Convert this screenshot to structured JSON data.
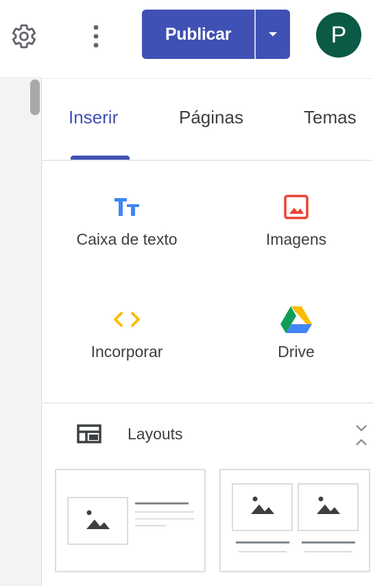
{
  "header": {
    "settings_icon": "gear-icon",
    "more_icon": "more-vert-icon",
    "publish_label": "Publicar",
    "publish_dropdown_icon": "arrow-drop-down-icon",
    "avatar_letter": "P"
  },
  "tabs": [
    {
      "label": "Inserir",
      "active": true
    },
    {
      "label": "Páginas",
      "active": false
    },
    {
      "label": "Temas",
      "active": false
    }
  ],
  "insert_tools": [
    {
      "label": "Caixa de texto",
      "icon": "text-box-icon"
    },
    {
      "label": "Imagens",
      "icon": "image-icon"
    },
    {
      "label": "Incorporar",
      "icon": "embed-code-icon"
    },
    {
      "label": "Drive",
      "icon": "google-drive-icon"
    }
  ],
  "layouts": {
    "label": "Layouts",
    "icon": "layouts-icon",
    "collapse_icon": "collapse-icon"
  },
  "colors": {
    "accent": "#3f51b5",
    "avatar_bg": "#0b5a45",
    "text_tool_icon": "#4285f4",
    "image_icon": "#ea4335",
    "embed_icon": "#fbbc04"
  }
}
